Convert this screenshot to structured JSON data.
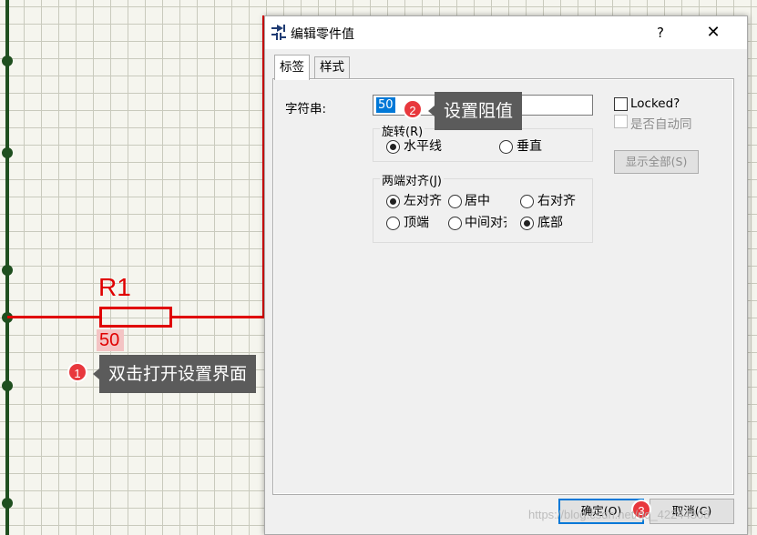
{
  "schematic": {
    "component_ref": "R1",
    "component_value": "50"
  },
  "callouts": [
    {
      "number": "1",
      "text": "双击打开设置界面"
    },
    {
      "number": "2",
      "text": "设置阻值"
    },
    {
      "number": "3"
    }
  ],
  "dialog": {
    "title": "编辑零件值",
    "help_label": "?",
    "close_label": "✕",
    "tabs": [
      "标签",
      "样式"
    ],
    "string_label": "字符串:",
    "string_value": "50",
    "rotation": {
      "title": "旋转(R)",
      "options": [
        {
          "label": "水平线",
          "selected": true
        },
        {
          "label": "垂直",
          "selected": false
        }
      ]
    },
    "justify": {
      "title": "两端对齐(J)",
      "options": [
        {
          "label": "左对齐",
          "selected": true
        },
        {
          "label": "居中",
          "selected": false
        },
        {
          "label": "右对齐",
          "selected": false
        },
        {
          "label": "顶端",
          "selected": false
        },
        {
          "label": "中间对齐",
          "selected": false
        },
        {
          "label": "底部",
          "selected": true
        }
      ]
    },
    "locked_label": "Locked?",
    "auto_sync_label": "是否自动同",
    "show_all_label": "显示全部(S)",
    "ok_label": "确定(O)",
    "cancel_label": "取消(C)"
  },
  "watermark": "https://blog.csdn.net/qq_42244808",
  "colors": {
    "wire": "#e00000",
    "bus": "#1f4f1f",
    "callout_badge": "#e8383d",
    "callout_bg": "#5b5b5b",
    "selection": "#0078d7"
  },
  "icons": [
    "component-icon",
    "close-icon",
    "help-icon"
  ]
}
